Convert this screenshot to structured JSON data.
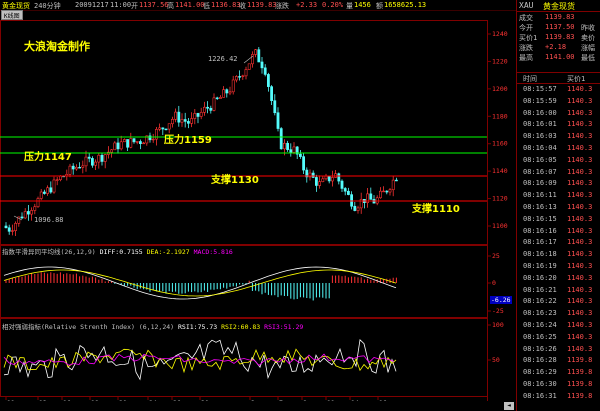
{
  "topbar": {
    "symbol": "黄金现货",
    "period": "240分钟",
    "date": "20091217",
    "time": "11:00",
    "open_label": "开",
    "open": "1137.56",
    "high_label": "高",
    "high": "1141.00",
    "low_label": "低",
    "low": "1136.83",
    "close_label": "收",
    "close": "1139.83",
    "change_label": "涨跌",
    "change": "+2.33",
    "pct": "0.20%",
    "vol_label": "量",
    "vol": "1456",
    "amount_label": "额",
    "amount": "1658625.13"
  },
  "tabs": {
    "chart_tab": "K线图"
  },
  "annotations": {
    "title": "大浪淘金制作",
    "res1": "压力1159",
    "res2": "压力1147",
    "sup1": "支撑1130",
    "sup2": "支撑1110",
    "high_mark": "1226.42",
    "low_mark": "1096.88"
  },
  "main_axis": [
    "1240",
    "1220",
    "1200",
    "1180",
    "1160",
    "1140",
    "1120",
    "1100"
  ],
  "macd": {
    "title": "指数平滑异同平均线",
    "params": "(26,12,9)",
    "diff_label": "DIFF:",
    "diff": "0.7155",
    "dea_label": "DEA:",
    "dea": "-2.1927",
    "macd_label": "MACD:",
    "macd": "5.816",
    "axis": [
      "25",
      "0",
      "-25"
    ],
    "readout": "-6.26"
  },
  "rsi": {
    "title": "相对强弱指标",
    "subtitle": "(Relative Strenth Index)",
    "params": "(6,12,24)",
    "rsi1_label": "RSI1:",
    "rsi1": "75.73",
    "rsi2_label": "RSI2:",
    "rsi2": "60.83",
    "rsi3_label": "RSI3:",
    "rsi3": "51.29",
    "axis": [
      "100",
      "50"
    ]
  },
  "date_axis": [
    "11",
    "13",
    "16",
    "18",
    "20",
    "24",
    "26",
    "30",
    "3",
    "7",
    "9",
    "11",
    "14",
    "16"
  ],
  "right_panel": {
    "code": "XAU",
    "name": "黄金现货",
    "quote": [
      {
        "label": "成交",
        "value": "1139.83",
        "value2": ""
      },
      {
        "label": "今开",
        "value": "1137.50",
        "value2": "昨收"
      },
      {
        "label": "买价1",
        "value": "1139.83",
        "value2": "卖价"
      },
      {
        "label": "涨跌",
        "value": "+2.18",
        "value2": "涨幅"
      },
      {
        "label": "最高",
        "value": "1141.00",
        "value2": "最低"
      }
    ],
    "header": {
      "time": "时间",
      "price": "买价1"
    },
    "ticks": [
      {
        "time": "08:15:57",
        "price": "1140.3"
      },
      {
        "time": "08:15:59",
        "price": "1140.3"
      },
      {
        "time": "08:16:00",
        "price": "1140.3"
      },
      {
        "time": "08:16:01",
        "price": "1140.3"
      },
      {
        "time": "08:16:03",
        "price": "1140.3"
      },
      {
        "time": "08:16:04",
        "price": "1140.3"
      },
      {
        "time": "08:16:05",
        "price": "1140.3"
      },
      {
        "time": "08:16:07",
        "price": "1140.3"
      },
      {
        "time": "08:16:09",
        "price": "1140.3"
      },
      {
        "time": "08:16:11",
        "price": "1140.3"
      },
      {
        "time": "08:16:13",
        "price": "1140.3"
      },
      {
        "time": "08:16:15",
        "price": "1140.3"
      },
      {
        "time": "08:16:16",
        "price": "1140.3"
      },
      {
        "time": "08:16:17",
        "price": "1140.3"
      },
      {
        "time": "08:16:18",
        "price": "1140.3"
      },
      {
        "time": "08:16:19",
        "price": "1140.3"
      },
      {
        "time": "08:16:20",
        "price": "1140.3"
      },
      {
        "time": "08:16:21",
        "price": "1140.3"
      },
      {
        "time": "08:16:22",
        "price": "1140.3"
      },
      {
        "time": "08:16:23",
        "price": "1140.3"
      },
      {
        "time": "08:16:24",
        "price": "1140.3"
      },
      {
        "time": "08:16:25",
        "price": "1140.3"
      },
      {
        "time": "08:16:26",
        "price": "1140.3"
      },
      {
        "time": "08:16:28",
        "price": "1139.8"
      },
      {
        "time": "08:16:29",
        "price": "1139.8"
      },
      {
        "time": "08:16:30",
        "price": "1139.8"
      },
      {
        "time": "08:16:31",
        "price": "1139.8"
      }
    ]
  },
  "colors": {
    "up": "#ff3232",
    "down": "#54fcfc",
    "support": "#ff0000",
    "resist": "#00ff00",
    "label": "#ffff00",
    "border": "#800000"
  }
}
